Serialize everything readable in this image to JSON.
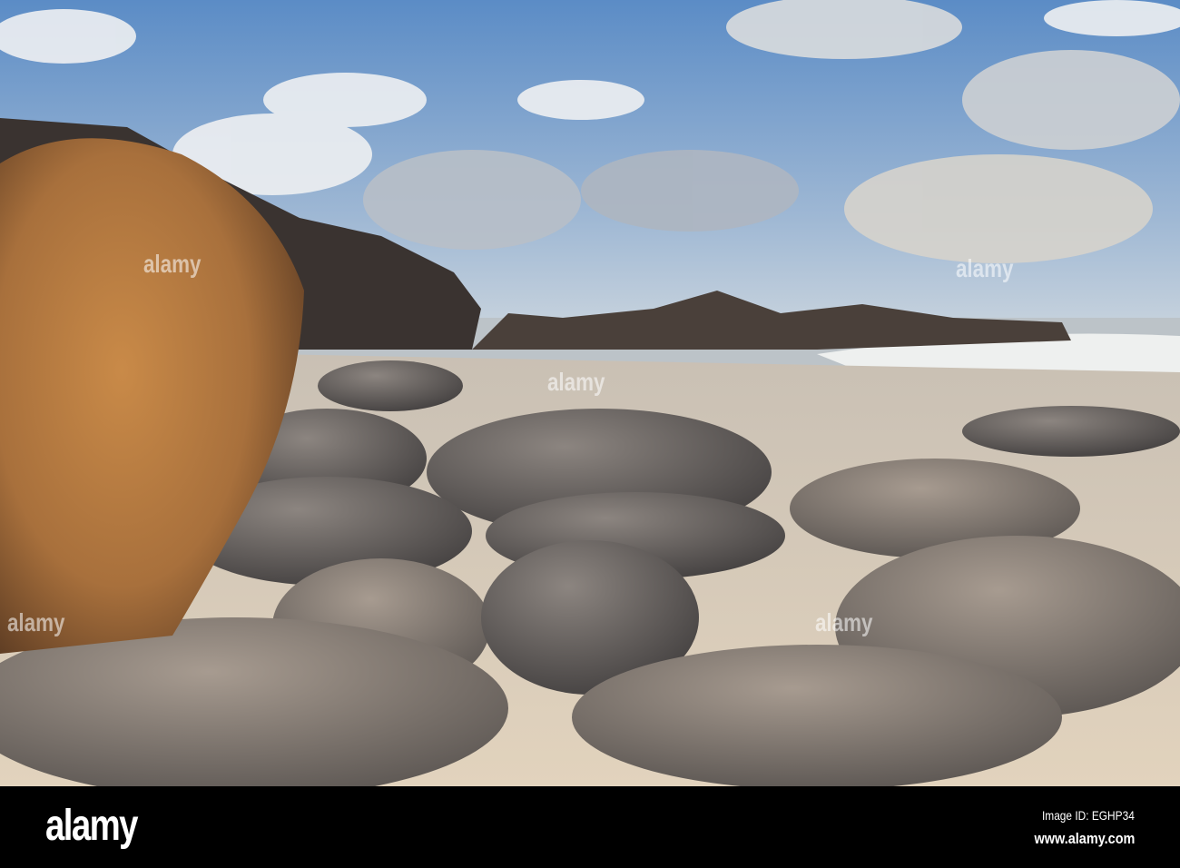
{
  "watermark": {
    "logo": "alamy",
    "image_id": "Image ID: EGHP34",
    "url": "www.alamy.com"
  },
  "colors": {
    "sky_top": "#5f8fc8",
    "sky_low": "#c9d6e2",
    "sand": "#d8cbb8",
    "boulder_warm": "#b87a3e",
    "boulder_grey": "#6e6b6a",
    "footer": "#000000"
  }
}
